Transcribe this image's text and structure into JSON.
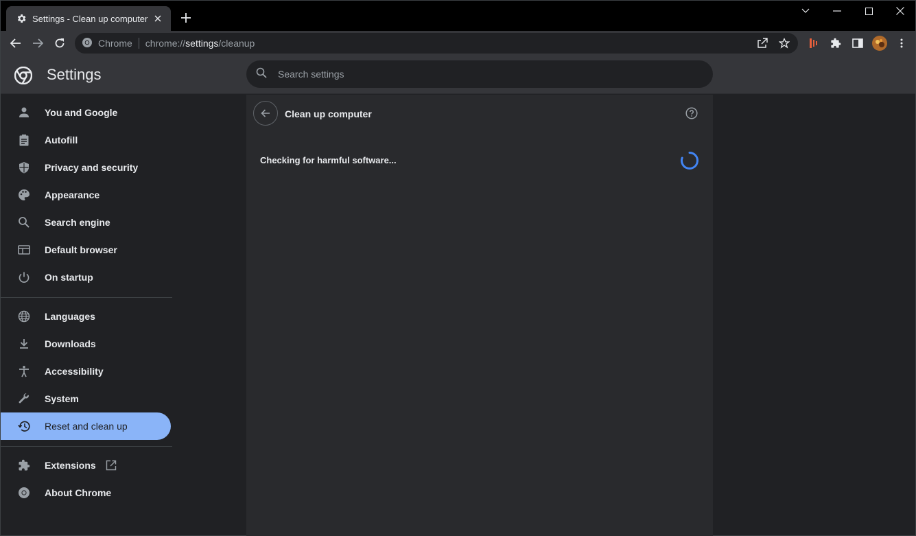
{
  "tab": {
    "title": "Settings - Clean up computer"
  },
  "omnibox": {
    "site_label": "Chrome",
    "url_scheme": "chrome://",
    "url_host": "settings",
    "url_path": "/cleanup"
  },
  "header": {
    "title": "Settings",
    "search_placeholder": "Search settings"
  },
  "sidebar": {
    "items": [
      {
        "label": "You and Google"
      },
      {
        "label": "Autofill"
      },
      {
        "label": "Privacy and security"
      },
      {
        "label": "Appearance"
      },
      {
        "label": "Search engine"
      },
      {
        "label": "Default browser"
      },
      {
        "label": "On startup"
      },
      {
        "label": "Languages"
      },
      {
        "label": "Downloads"
      },
      {
        "label": "Accessibility"
      },
      {
        "label": "System"
      },
      {
        "label": "Reset and clean up"
      },
      {
        "label": "Extensions"
      },
      {
        "label": "About Chrome"
      }
    ],
    "active_item": "Reset and clean up"
  },
  "main": {
    "title": "Clean up computer",
    "status": "Checking for harmful software..."
  },
  "colors": {
    "accent": "#8ab4f8",
    "spinner": "#4285f4",
    "background": "#202124",
    "card": "#292a2d"
  },
  "icons": [
    "gear-icon",
    "close-icon",
    "plus-icon",
    "back-arrow-icon",
    "forward-arrow-icon",
    "reload-icon",
    "share-icon",
    "star-icon",
    "puzzle-icon",
    "side-panel-icon",
    "avatar",
    "kebab-menu-icon",
    "chrome-logo-icon",
    "search-icon",
    "help-icon",
    "spinner-icon"
  ]
}
